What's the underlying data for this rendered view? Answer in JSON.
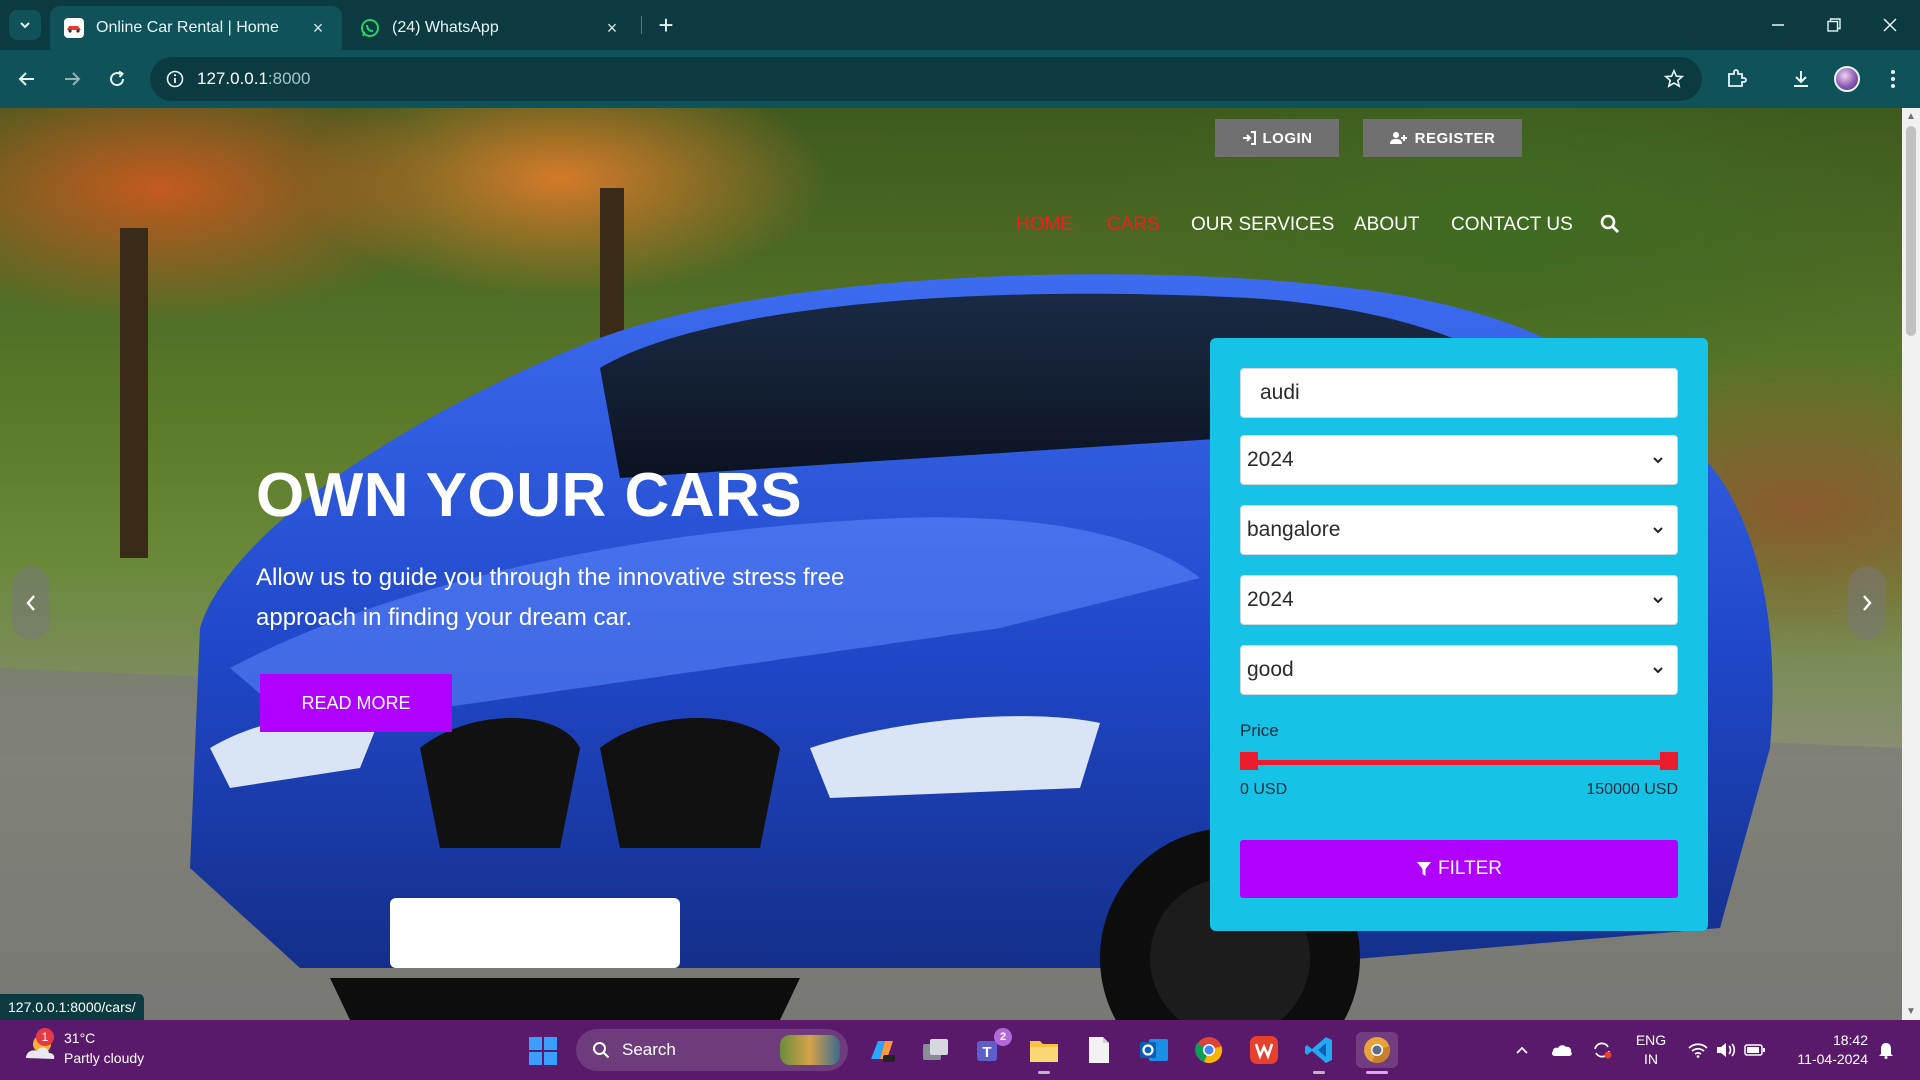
{
  "browser": {
    "tabs": [
      {
        "title": "Online Car Rental | Home",
        "active": true
      },
      {
        "title": "(24) WhatsApp",
        "active": false
      }
    ],
    "address": {
      "host": "127.0.0.1",
      "port": ":8000"
    },
    "status_url": "127.0.0.1:8000/cars/"
  },
  "site": {
    "top_buttons": {
      "login": "LOGIN",
      "register": "REGISTER"
    },
    "nav": {
      "items": [
        "HOME",
        "CARS",
        "OUR SERVICES",
        "ABOUT",
        "CONTACT US"
      ],
      "active_index": 0
    },
    "hero": {
      "title": "OWN YOUR CARS",
      "subtitle": "Allow us to guide you through the innovative stress free approach in finding your dream car.",
      "cta": "READ MORE"
    },
    "filter": {
      "search_value": "audi",
      "selects": [
        "2024",
        "bangalore",
        "2024",
        "good"
      ],
      "price_label": "Price",
      "price_min": "0 USD",
      "price_max": "150000 USD",
      "price_range_fraction": [
        0,
        1
      ],
      "button": "FILTER"
    },
    "colors": {
      "accent": "#b000ff",
      "panel": "#16c3e6",
      "nav_active": "#ff1a1a",
      "slider": "#ea1c2d"
    }
  },
  "taskbar": {
    "weather": {
      "temp": "31°C",
      "desc": "Partly cloudy",
      "badge": "1"
    },
    "search_label": "Search",
    "teams_badge": "2",
    "lang": {
      "line1": "ENG",
      "line2": "IN"
    },
    "clock": {
      "time": "18:42",
      "date": "11-04-2024"
    },
    "apps": [
      "copilot-icon",
      "task-view-icon",
      "teams-icon",
      "file-explorer-icon",
      "notepad-icon",
      "outlook-icon",
      "chrome-icon",
      "wps-office-icon",
      "vscode-icon",
      "chrome-canary-icon"
    ]
  }
}
